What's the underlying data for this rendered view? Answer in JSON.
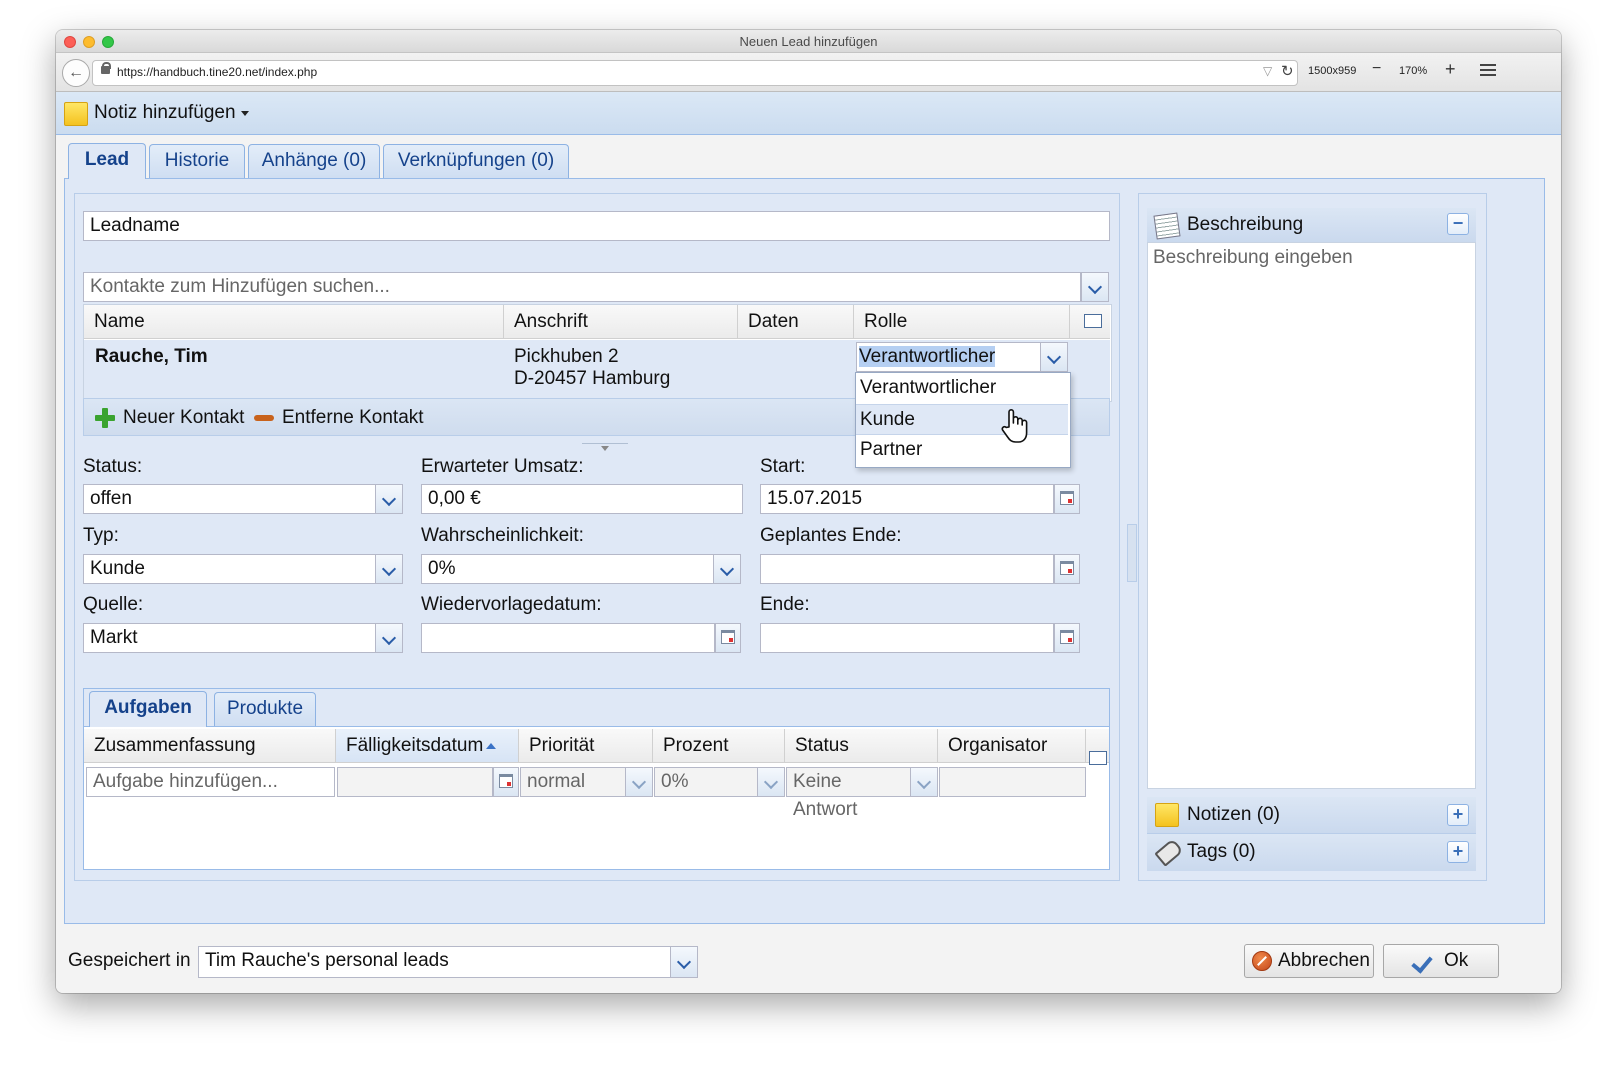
{
  "window": {
    "title": "Neuen Lead hinzufügen"
  },
  "browser": {
    "url": "https://handbuch.tine20.net/index.php",
    "resolution": "1500x959",
    "zoom": "170%",
    "zoom_out": "−",
    "zoom_in": "+"
  },
  "header": {
    "add_note_label": "Notiz hinzufügen"
  },
  "tabs": [
    {
      "label": "Lead"
    },
    {
      "label": "Historie"
    },
    {
      "label": "Anhänge (0)"
    },
    {
      "label": "Verknüpfungen (0)"
    }
  ],
  "lead": {
    "name_value": "Leadname",
    "contact_search_placeholder": "Kontakte zum Hinzufügen suchen..."
  },
  "contacts_grid": {
    "columns": [
      "Name",
      "Anschrift",
      "Daten",
      "Rolle"
    ],
    "rows": [
      {
        "name": "Rauche, Tim",
        "address_line1": "Pickhuben 2",
        "address_line2": "D-20457 Hamburg",
        "role": "Verantwortlicher"
      }
    ],
    "toolbar": {
      "new_contact": "Neuer Kontakt",
      "remove_contact": "Entferne Kontakt"
    }
  },
  "role_dropdown": {
    "options": [
      "Verantwortlicher",
      "Kunde",
      "Partner"
    ],
    "hovered": "Kunde"
  },
  "form": {
    "status_label": "Status:",
    "status_value": "offen",
    "expected_revenue_label": "Erwarteter Umsatz:",
    "expected_revenue_value": "0,00 €",
    "start_label": "Start:",
    "start_value": "15.07.2015",
    "type_label": "Typ:",
    "type_value": "Kunde",
    "probability_label": "Wahrscheinlichkeit:",
    "probability_value": "0%",
    "planned_end_label": "Geplantes Ende:",
    "source_label": "Quelle:",
    "source_value": "Markt",
    "resubmission_label": "Wiedervorlagedatum:",
    "end_label": "Ende:"
  },
  "subtabs": [
    {
      "label": "Aufgaben"
    },
    {
      "label": "Produkte"
    }
  ],
  "tasks_grid": {
    "columns": [
      "Zusammenfassung",
      "Fälligkeitsdatum",
      "Priorität",
      "Prozent",
      "Status",
      "Organisator"
    ],
    "new_row": {
      "summary_placeholder": "Aufgabe hinzufügen...",
      "priority": "normal",
      "percent": "0%",
      "status": "Keine Antwort"
    }
  },
  "sidebar": {
    "description_title": "Beschreibung",
    "description_placeholder": "Beschreibung eingeben",
    "notes_label": "Notizen (0)",
    "tags_label": "Tags (0)"
  },
  "footer": {
    "saved_in_label": "Gespeichert in",
    "container_value": "Tim Rauche's personal leads",
    "cancel_label": "Abbrechen",
    "ok_label": "Ok"
  }
}
